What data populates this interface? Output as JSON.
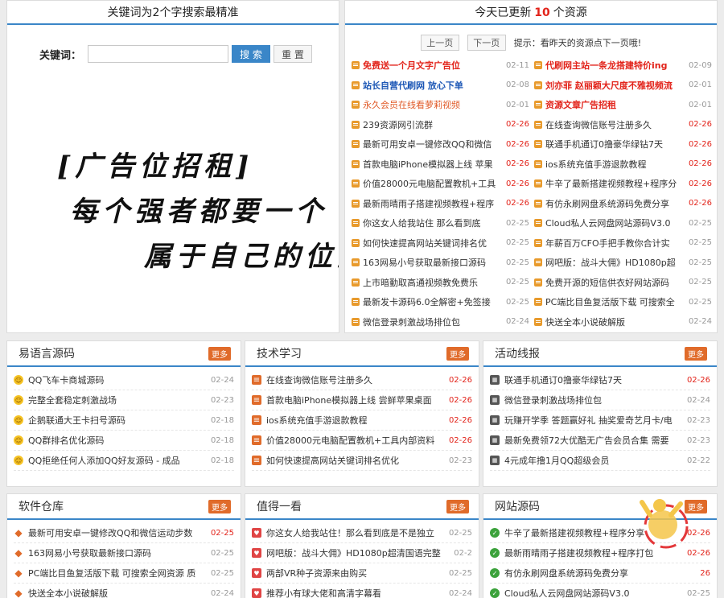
{
  "search": {
    "title": "关键词为2个字搜索最精准",
    "label": "关键词：",
    "input_value": "",
    "search_button": "搜 索",
    "reset_button": "重 置",
    "ad_lines": [
      "[广告位招租]",
      "每个强者都要一个",
      "属于自己的位置"
    ]
  },
  "resources": {
    "title_prefix": "今天已更新",
    "count": "10",
    "title_suffix": "个资源",
    "prev_button": "上一页",
    "next_button": "下一页",
    "tip": "提示：看昨天的资源点下一页哦!",
    "items": [
      {
        "text": "免费送一个月文字广告位",
        "date": "02-11",
        "style": "red"
      },
      {
        "text": "代刷网主站一条龙搭建特价ing",
        "date": "02-09",
        "style": "red"
      },
      {
        "text": "站长自营代刷网 放心下单",
        "date": "02-08",
        "style": "blue"
      },
      {
        "text": "刘亦菲 赵丽颖大尺度不雅视频流",
        "date": "02-01",
        "style": "red"
      },
      {
        "text": "永久会员在线看萝莉视频",
        "date": "02-01",
        "style": "orange"
      },
      {
        "text": "资源文章广告招租",
        "date": "02-01",
        "style": "red"
      },
      {
        "text": "239资源网引流群",
        "date": "02-26",
        "style": ""
      },
      {
        "text": "在线查询微信账号注册多久",
        "date": "02-26",
        "style": ""
      },
      {
        "text": "最新可用安卓一键修改QQ和微信",
        "date": "02-26",
        "style": ""
      },
      {
        "text": "联通手机通订0撸豪华绿钻7天",
        "date": "02-26",
        "style": ""
      },
      {
        "text": "首款电脑iPhone模拟器上线 苹果",
        "date": "02-26",
        "style": ""
      },
      {
        "text": "ios系统充值手游退款教程",
        "date": "02-26",
        "style": ""
      },
      {
        "text": "价值28000元电脑配置教机+工具",
        "date": "02-26",
        "style": ""
      },
      {
        "text": "牛辛了最新搭建视频教程+程序分",
        "date": "02-26",
        "style": ""
      },
      {
        "text": "最新雨晴雨子搭建视频教程+程序",
        "date": "02-26",
        "style": ""
      },
      {
        "text": "有仿永刷网盘系统源码免费分享",
        "date": "02-26",
        "style": ""
      },
      {
        "text": "你这女人给我站住 那么看到底",
        "date": "02-25",
        "style": ""
      },
      {
        "text": "Cloud私人云网盘网站源码V3.0",
        "date": "02-25",
        "style": ""
      },
      {
        "text": "如何快速提高网站关键词排名优",
        "date": "02-25",
        "style": ""
      },
      {
        "text": "年薪百万CFO手把手教你合计实",
        "date": "02-25",
        "style": ""
      },
      {
        "text": "163网易小号获取最新接口源码",
        "date": "02-25",
        "style": ""
      },
      {
        "text": "网吧版：战斗大佣》HD1080p超",
        "date": "02-25",
        "style": ""
      },
      {
        "text": "上市暗勤取高通视频教免费乐",
        "date": "02-25",
        "style": ""
      },
      {
        "text": "免费开源的短信供衣好网站源码",
        "date": "02-25",
        "style": ""
      },
      {
        "text": "最新发卡源码6.0全解密+免签接",
        "date": "02-25",
        "style": ""
      },
      {
        "text": "PC端比目鱼复活版下载 可搜索全",
        "date": "02-25",
        "style": ""
      },
      {
        "text": "微信登录刺激战场排位包",
        "date": "02-24",
        "style": ""
      },
      {
        "text": "快送全本小说破解版",
        "date": "02-24",
        "style": ""
      }
    ]
  },
  "sections": [
    {
      "title": "易语言源码",
      "more": "更多",
      "icon": "smile",
      "items": [
        {
          "text": "QQ飞车卡商城源码",
          "date": "02-24",
          "hot": false
        },
        {
          "text": "完整全套稳定刺激战场",
          "date": "02-23",
          "hot": false
        },
        {
          "text": "企鹅联通大王卡扫号源码",
          "date": "02-18",
          "hot": false
        },
        {
          "text": "QQ群排名优化源码",
          "date": "02-18",
          "hot": false
        },
        {
          "text": "QQ拒绝任何人添加QQ好友源码 - 成品",
          "date": "02-18",
          "hot": false
        }
      ]
    },
    {
      "title": "技术学习",
      "more": "更多",
      "icon": "note",
      "items": [
        {
          "text": "在线查询微信账号注册多久",
          "date": "02-26",
          "hot": true
        },
        {
          "text": "首款电脑iPhone模拟器上线 尝鲜苹果桌面",
          "date": "02-26",
          "hot": true
        },
        {
          "text": "ios系统充值手游退款教程",
          "date": "02-26",
          "hot": true
        },
        {
          "text": "价值28000元电脑配置教机+工具内部资料",
          "date": "02-26",
          "hot": true
        },
        {
          "text": "如何快速提高网站关键词排名优化",
          "date": "02-23",
          "hot": false
        }
      ]
    },
    {
      "title": "活动线报",
      "more": "更多",
      "icon": "film",
      "items": [
        {
          "text": "联通手机通订0撸豪华绿钻7天",
          "date": "02-26",
          "hot": true
        },
        {
          "text": "微信登录刺激战场排位包",
          "date": "02-24",
          "hot": false
        },
        {
          "text": "玩赚开学季 答题赢好礼 抽奖爱奇艺月卡/电",
          "date": "02-23",
          "hot": false
        },
        {
          "text": "最新免费领72大优酷无广告会员合集 需要",
          "date": "02-23",
          "hot": false
        },
        {
          "text": "4元成年撸1月QQ超级会员",
          "date": "02-22",
          "hot": false
        }
      ]
    },
    {
      "title": "软件仓库",
      "more": "更多",
      "icon": "diamond",
      "items": [
        {
          "text": "最新可用安卓一键修改QQ和微信运动步数",
          "date": "02-25",
          "hot": true
        },
        {
          "text": "163网易小号获取最新接口源码",
          "date": "02-25",
          "hot": false
        },
        {
          "text": "PC端比目鱼复活版下载 可搜索全网资源 质",
          "date": "02-25",
          "hot": false
        },
        {
          "text": "快送全本小说破解版",
          "date": "02-24",
          "hot": false
        }
      ]
    },
    {
      "title": "值得一看",
      "more": "更多",
      "icon": "heart",
      "items": [
        {
          "text": "你这女人给我站住！那么看到底是不是独立",
          "date": "02-25",
          "hot": false
        },
        {
          "text": "网吧版：战斗大佣》HD1080p超清国语完整",
          "date": "02-2",
          "hot": false
        },
        {
          "text": "两部VR种子资源来由购买",
          "date": "02-25",
          "hot": false
        },
        {
          "text": "推荐小有球大佬和高清字幕看",
          "date": "02-24",
          "hot": false
        }
      ]
    },
    {
      "title": "网站源码",
      "more": "更多",
      "icon": "check",
      "items": [
        {
          "text": "牛辛了最新搭建视频教程+程序分享",
          "date": "02-26",
          "hot": true
        },
        {
          "text": "最新雨晴雨子搭建视频教程+程序打包",
          "date": "02-26",
          "hot": true
        },
        {
          "text": "有仿永刷网盘系统源码免费分享",
          "date": "26",
          "hot": true
        },
        {
          "text": "Cloud私人云网盘网站源码V3.0",
          "date": "02-25",
          "hot": false
        }
      ]
    }
  ]
}
